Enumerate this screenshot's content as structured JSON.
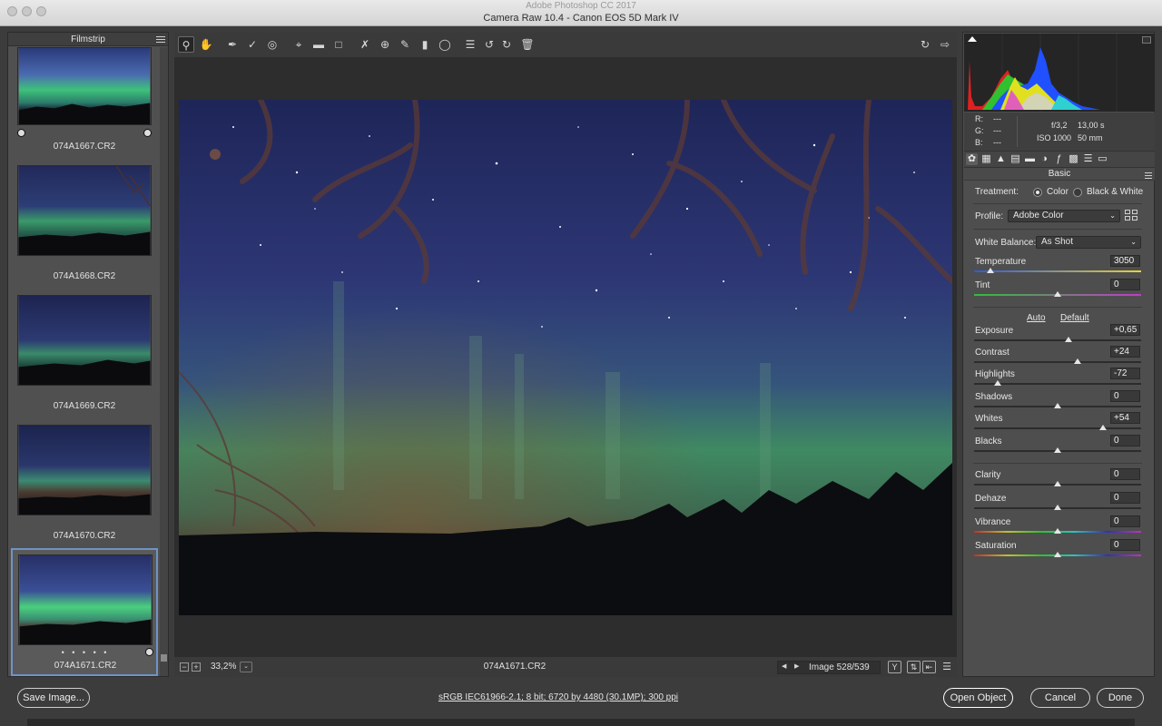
{
  "window": {
    "app_title": "Adobe Photoshop CC 2017",
    "title": "Camera Raw 10.4  -  Canon EOS 5D Mark IV"
  },
  "filmstrip": {
    "title": "Filmstrip",
    "items": [
      {
        "name": "074A1667.CR2"
      },
      {
        "name": "074A1668.CR2"
      },
      {
        "name": "074A1669.CR2"
      },
      {
        "name": "074A1670.CR2"
      },
      {
        "name": "074A1671.CR2",
        "selected": true,
        "rating_dots": "• • • • •"
      }
    ]
  },
  "toolbar": {
    "tools": [
      "zoom-tool-icon",
      "hand-tool-icon",
      "white-balance-tool-icon",
      "color-sampler-tool-icon",
      "targeted-adjustment-tool-icon",
      "crop-tool-icon",
      "straighten-tool-icon",
      "transform-tool-icon",
      "spot-removal-tool-icon",
      "red-eye-removal-icon",
      "adjustment-brush-icon",
      "graduated-filter-icon",
      "radial-filter-icon",
      "preferences-icon",
      "rotate-left-icon",
      "rotate-right-icon",
      "delete-icon"
    ],
    "right_tools": [
      "toggle-fullscreen-icon",
      "open-preferences-icon"
    ]
  },
  "statusbar": {
    "zoom": "33,2%",
    "filename": "074A1671.CR2",
    "image_counter": "Image 528/539"
  },
  "info": {
    "r_label": "R:",
    "g_label": "G:",
    "b_label": "B:",
    "r_value": "---",
    "g_value": "---",
    "b_value": "---",
    "aperture": "f/3,2",
    "shutter": "13,00 s",
    "iso": "ISO 1000",
    "focal": "50 mm"
  },
  "panel": {
    "section_title": "Basic",
    "treatment_label": "Treatment:",
    "treatment_color": "Color",
    "treatment_bw": "Black & White",
    "profile_label": "Profile:",
    "profile_value": "Adobe Color",
    "wb_label": "White Balance:",
    "wb_value": "As Shot",
    "auto": "Auto",
    "default": "Default",
    "sliders": {
      "temperature": {
        "label": "Temperature",
        "value": "3050",
        "pos": 0.1
      },
      "tint": {
        "label": "Tint",
        "value": "0",
        "pos": 0.5
      },
      "exposure": {
        "label": "Exposure",
        "value": "+0,65",
        "pos": 0.565
      },
      "contrast": {
        "label": "Contrast",
        "value": "+24",
        "pos": 0.62
      },
      "highlights": {
        "label": "Highlights",
        "value": "-72",
        "pos": 0.14
      },
      "shadows": {
        "label": "Shadows",
        "value": "0",
        "pos": 0.5
      },
      "whites": {
        "label": "Whites",
        "value": "+54",
        "pos": 0.77
      },
      "blacks": {
        "label": "Blacks",
        "value": "0",
        "pos": 0.5
      },
      "clarity": {
        "label": "Clarity",
        "value": "0",
        "pos": 0.5
      },
      "dehaze": {
        "label": "Dehaze",
        "value": "0",
        "pos": 0.5
      },
      "vibrance": {
        "label": "Vibrance",
        "value": "0",
        "pos": 0.5
      },
      "saturation": {
        "label": "Saturation",
        "value": "0",
        "pos": 0.5
      }
    }
  },
  "bottom": {
    "save_image": "Save Image...",
    "workflow": "sRGB IEC61966-2.1; 8 bit; 6720 by 4480 (30.1MP); 300 ppi",
    "open_object": "Open Object",
    "cancel": "Cancel",
    "done": "Done"
  },
  "colors": {
    "selection_blue": "#6f93c8",
    "panel_bg": "#4e4e4e",
    "canvas_bg": "#2d2d2d"
  }
}
